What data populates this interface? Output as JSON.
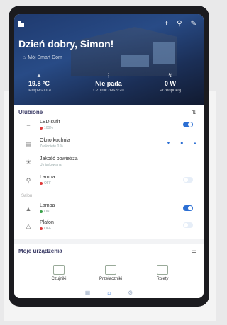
{
  "hero": {
    "greeting": "Dzień dobry, Simon!",
    "home_name": "Mój Smart Dom",
    "icons": [
      "plus-icon",
      "search-icon",
      "edit-icon"
    ],
    "stats": [
      {
        "icon": "thermometer-icon",
        "value": "19.8 °C",
        "label": "Temperatura"
      },
      {
        "icon": "rain-icon",
        "value": "Nie pada",
        "label": "Czujnik deszczu"
      },
      {
        "icon": "lightning-icon",
        "value": "0 W",
        "label": "Przedpokój"
      }
    ]
  },
  "favorites": {
    "title": "Ulubione",
    "items": [
      {
        "name": "LED sufit",
        "sub": "100%",
        "sub_color": "#e03a3a",
        "icon": "led-strip-icon",
        "control": "toggle-on"
      },
      {
        "name": "Okno kuchnia",
        "sub": "Zasłonięte 0 %",
        "icon": "blinds-icon",
        "control": "blinds"
      },
      {
        "name": "Jakość powietrza",
        "sub": "Umiarkowana",
        "icon": "air-quality-icon",
        "control": "none"
      },
      {
        "name": "Lampa",
        "sub": "OFF",
        "sub_color": "#e03a3a",
        "icon": "lamp-icon",
        "control": "toggle-off"
      }
    ],
    "group_label": "Salon",
    "group_items": [
      {
        "name": "Lampa",
        "sub": "ON",
        "sub_color": "#3aa04a",
        "icon": "ceiling-lamp-icon",
        "control": "toggle-on"
      },
      {
        "name": "Plafon",
        "sub": "OFF",
        "sub_color": "#e03a3a",
        "icon": "plafon-icon",
        "control": "toggle-off"
      }
    ]
  },
  "devices": {
    "title": "Moje urządzenia",
    "categories": [
      {
        "label": "Czujniki",
        "icon": "sensor-icon"
      },
      {
        "label": "Przełączniki",
        "icon": "switch-icon"
      },
      {
        "label": "Rolety",
        "icon": "roller-blind-icon"
      }
    ]
  },
  "nav": [
    "grid-icon",
    "home-icon",
    "settings-icon"
  ],
  "colors": {
    "accent": "#2c6fd3",
    "hero": "#284b86"
  }
}
